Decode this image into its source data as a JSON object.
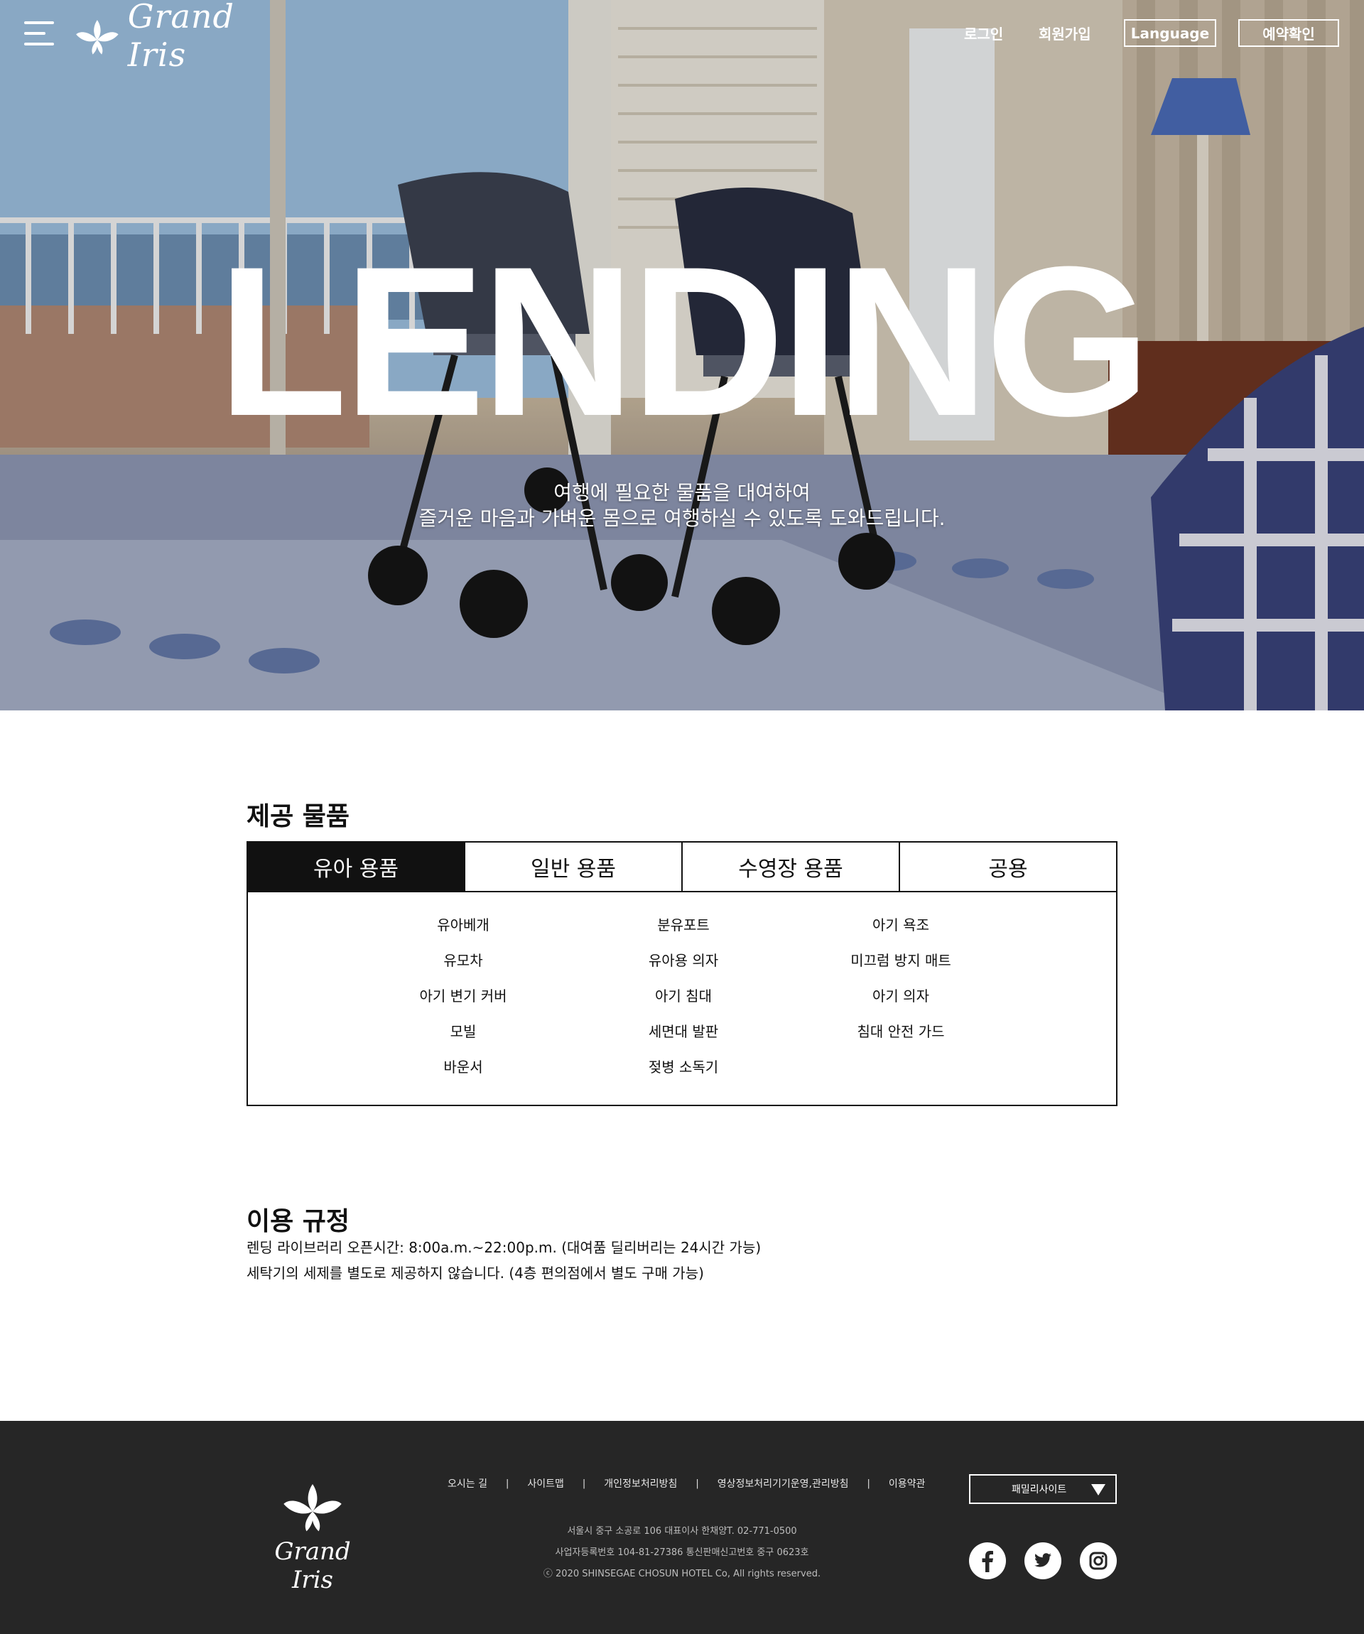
{
  "header": {
    "logo_text": "Grand Iris",
    "login": "로그인",
    "signup": "회원가입",
    "language": "Language",
    "reservation": "예약확인"
  },
  "hero": {
    "title": "LENDING",
    "sub_line1": "여행에 필요한 물품을 대여하여",
    "sub_line2": "즐거운 마음과 가벼운 몸으로 여행하실 수 있도록 도와드립니다."
  },
  "products": {
    "title": "제공 물품",
    "tabs": [
      "유아 용품",
      "일반 용품",
      "수영장 용품",
      "공용"
    ],
    "active_tab": "유아 용품",
    "items": {
      "col1": [
        "유아베개",
        "유모차",
        "아기 변기 커버",
        "모빌",
        "바운서"
      ],
      "col2": [
        "분유포트",
        "유아용 의자",
        "아기 침대",
        "세면대 발판",
        "젖병 소독기"
      ],
      "col3": [
        "아기 욕조",
        "미끄럼 방지 매트",
        "아기 의자",
        "침대 안전 가드"
      ]
    }
  },
  "rules": {
    "title": "이용 규정",
    "line1": "렌딩 라이브러리 오픈시간: 8:00a.m.~22:00p.m. (대여품 딜리버리는 24시간 가능)",
    "line2": "세탁기의 세제를 별도로 제공하지 않습니다. (4층 편의점에서 별도 구매 가능)"
  },
  "footer": {
    "logo_text": "Grand Iris",
    "links": [
      "오시는 길",
      "사이트맵",
      "개인정보처리방침",
      "영상정보처리기기운영,관리방침",
      "이용약관"
    ],
    "address": "서울시 중구 소공로 106 대표이사 한채양T. 02-771-0500",
    "business": "사업자등록번호 104-81-27386 통신판매신고번호 중구 0623호",
    "copyright": "ⓒ 2020 SHINSEGAE CHOSUN HOTEL Co, All rights reserved.",
    "family_site": "패밀리사이트",
    "social": [
      "facebook-icon",
      "twitter-icon",
      "instagram-icon"
    ]
  },
  "colors": {
    "accent_dark": "#111111",
    "footer_bg": "#262626",
    "white": "#ffffff"
  }
}
